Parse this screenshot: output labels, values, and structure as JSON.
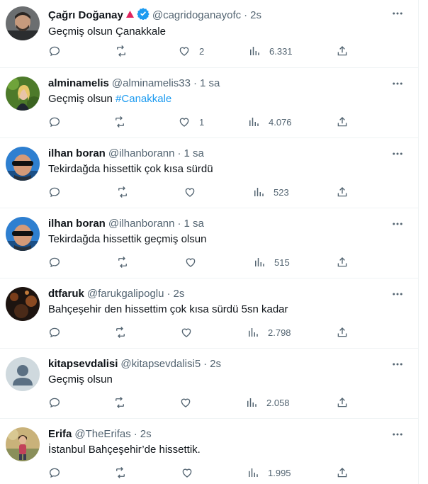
{
  "colors": {
    "accent": "#1d9bf0",
    "text": "#0f1419",
    "muted": "#536471",
    "border": "#eff3f4"
  },
  "tweets": [
    {
      "name": "Çağrı Doğanay",
      "handle": "@cagridoganayofc",
      "time": "2s",
      "text": "Geçmiş olsun Çanakkale",
      "likes": "2",
      "views": "6.331",
      "badges": [
        "red-triangle-icon",
        "verified-icon"
      ]
    },
    {
      "name": "alminamelis",
      "handle": "@alminamelis33",
      "time": "1 sa",
      "text_prefix": "Geçmiş olsun ",
      "hashtag": "#Canakkale",
      "likes": "1",
      "views": "4.076"
    },
    {
      "name": "ilhan boran",
      "handle": "@ilhanborann",
      "time": "1 sa",
      "text": "Tekirdağda hissettik çok kısa sürdü",
      "likes": "",
      "views": "523"
    },
    {
      "name": "ilhan boran",
      "handle": "@ilhanborann",
      "time": "1 sa",
      "text": "Tekirdağda hissettik geçmiş olsun",
      "likes": "",
      "views": "515"
    },
    {
      "name": "dtfaruk",
      "handle": "@farukgalipoglu",
      "time": "2s",
      "text": "Bahçeşehir den hissettim çok kısa sürdü 5sn kadar",
      "likes": "",
      "views": "2.798"
    },
    {
      "name": "kitapsevdalisi",
      "handle": "@kitapsevdalisi5",
      "time": "2s",
      "text": "Geçmiş olsun",
      "likes": "",
      "views": "2.058"
    },
    {
      "name": "Erifa",
      "handle": "@TheErifas",
      "time": "2s",
      "text": "İstanbul Bahçeşehir’de hissettik.",
      "likes": "",
      "views": "1.995"
    }
  ],
  "separator": "·"
}
